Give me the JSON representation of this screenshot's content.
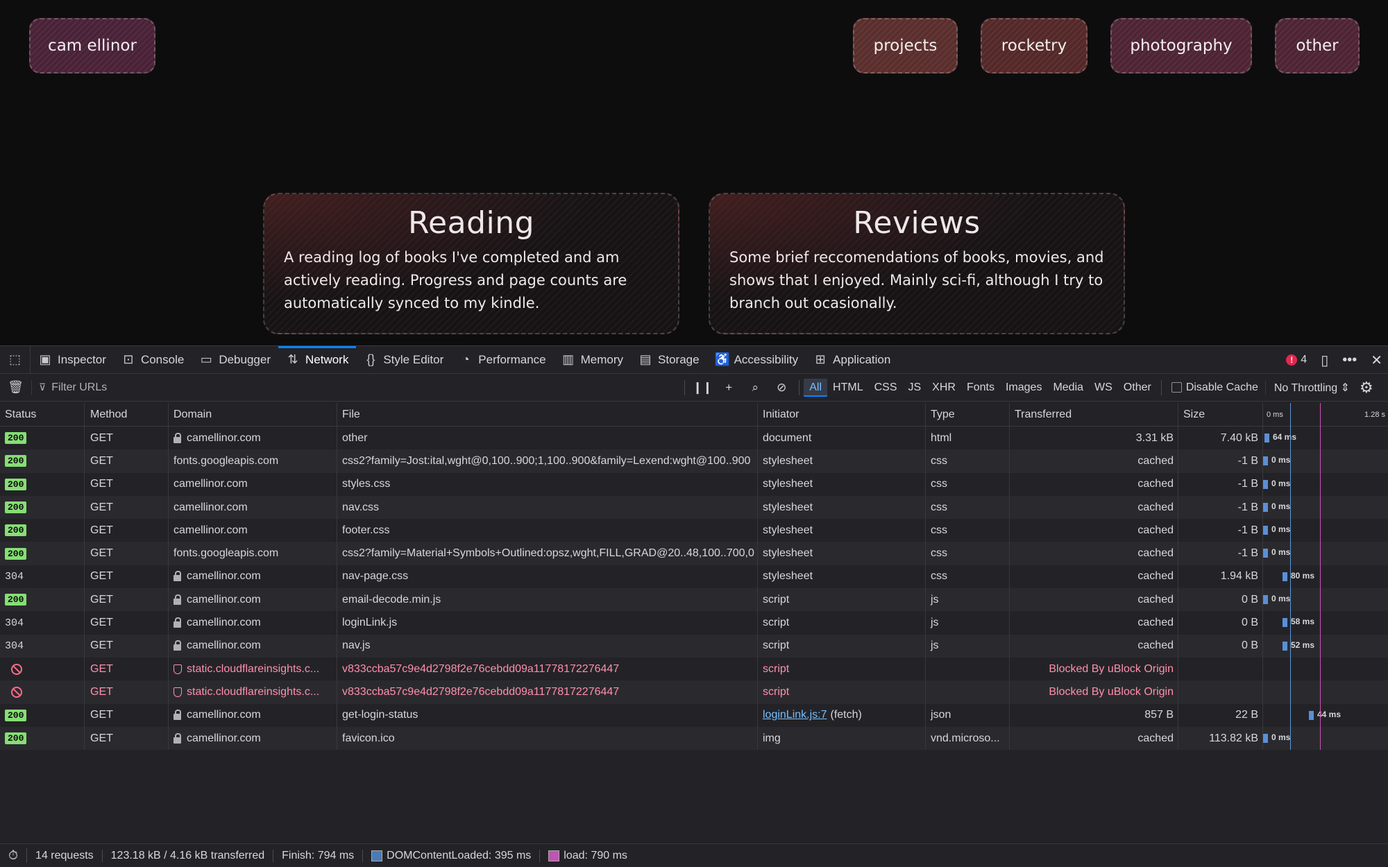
{
  "site": {
    "nav": {
      "home": "cam ellinor",
      "items": [
        "projects",
        "rocketry",
        "photography",
        "other"
      ]
    },
    "cards": [
      {
        "title": "Reading",
        "text": "A reading log of books I've completed and am actively reading. Progress and page counts are automatically synced to my kindle."
      },
      {
        "title": "Reviews",
        "text": "Some brief reccomendations of books, movies, and shows that I enjoyed. Mainly sci-fi, although I try to branch out ocasionally."
      }
    ]
  },
  "devtools": {
    "tabs": [
      {
        "label": "Inspector",
        "icon": "inspector-icon"
      },
      {
        "label": "Console",
        "icon": "console-icon"
      },
      {
        "label": "Debugger",
        "icon": "debugger-icon"
      },
      {
        "label": "Network",
        "icon": "network-icon",
        "active": true
      },
      {
        "label": "Style Editor",
        "icon": "braces-icon"
      },
      {
        "label": "Performance",
        "icon": "gauge-icon"
      },
      {
        "label": "Memory",
        "icon": "memory-icon"
      },
      {
        "label": "Storage",
        "icon": "storage-icon"
      },
      {
        "label": "Accessibility",
        "icon": "accessibility-icon"
      },
      {
        "label": "Application",
        "icon": "grid-icon"
      }
    ],
    "error_count": "4",
    "filter_placeholder": "Filter URLs",
    "type_filters": [
      "All",
      "HTML",
      "CSS",
      "JS",
      "XHR",
      "Fonts",
      "Images",
      "Media",
      "WS",
      "Other"
    ],
    "disable_cache_label": "Disable Cache",
    "throttling": "No Throttling",
    "columns": [
      "Status",
      "Method",
      "Domain",
      "File",
      "Initiator",
      "Type",
      "Transferred",
      "Size"
    ],
    "waterfall_ticks": {
      "start": "0 ms",
      "end": "1.28 s"
    },
    "accent_color": "#0a84ff",
    "requests": [
      {
        "status": "200",
        "method": "GET",
        "domain": "camellinor.com",
        "secure": true,
        "file": "other",
        "initiator": "document",
        "type": "html",
        "transferred": "3.31 kB",
        "size": "7.40 kB",
        "time": "64 ms"
      },
      {
        "status": "200",
        "method": "GET",
        "domain": "fonts.googleapis.com",
        "secure": false,
        "file": "css2?family=Jost:ital,wght@0,100..900;1,100..900&family=Lexend:wght@100..900",
        "initiator": "stylesheet",
        "type": "css",
        "transferred": "cached",
        "size": "-1 B",
        "time": "0 ms"
      },
      {
        "status": "200",
        "method": "GET",
        "domain": "camellinor.com",
        "secure": false,
        "file": "styles.css",
        "initiator": "stylesheet",
        "type": "css",
        "transferred": "cached",
        "size": "-1 B",
        "time": "0 ms"
      },
      {
        "status": "200",
        "method": "GET",
        "domain": "camellinor.com",
        "secure": false,
        "file": "nav.css",
        "initiator": "stylesheet",
        "type": "css",
        "transferred": "cached",
        "size": "-1 B",
        "time": "0 ms"
      },
      {
        "status": "200",
        "method": "GET",
        "domain": "camellinor.com",
        "secure": false,
        "file": "footer.css",
        "initiator": "stylesheet",
        "type": "css",
        "transferred": "cached",
        "size": "-1 B",
        "time": "0 ms"
      },
      {
        "status": "200",
        "method": "GET",
        "domain": "fonts.googleapis.com",
        "secure": false,
        "file": "css2?family=Material+Symbols+Outlined:opsz,wght,FILL,GRAD@20..48,100..700,0",
        "initiator": "stylesheet",
        "type": "css",
        "transferred": "cached",
        "size": "-1 B",
        "time": "0 ms"
      },
      {
        "status": "304",
        "method": "GET",
        "domain": "camellinor.com",
        "secure": true,
        "file": "nav-page.css",
        "initiator": "stylesheet",
        "type": "css",
        "transferred": "cached",
        "size": "1.94 kB",
        "time": "80 ms"
      },
      {
        "status": "200",
        "method": "GET",
        "domain": "camellinor.com",
        "secure": true,
        "file": "email-decode.min.js",
        "initiator": "script",
        "type": "js",
        "transferred": "cached",
        "size": "0 B",
        "time": "0 ms"
      },
      {
        "status": "304",
        "method": "GET",
        "domain": "camellinor.com",
        "secure": true,
        "file": "loginLink.js",
        "initiator": "script",
        "type": "js",
        "transferred": "cached",
        "size": "0 B",
        "time": "58 ms"
      },
      {
        "status": "304",
        "method": "GET",
        "domain": "camellinor.com",
        "secure": true,
        "file": "nav.js",
        "initiator": "script",
        "type": "js",
        "transferred": "cached",
        "size": "0 B",
        "time": "52 ms"
      },
      {
        "status": "blocked",
        "method": "GET",
        "domain": "static.cloudflareinsights.c...",
        "secure": false,
        "file": "v833ccba57c9e4d2798f2e76cebdd09a11778172276447",
        "initiator": "script",
        "type": "",
        "transferred": "Blocked By uBlock Origin",
        "size": "",
        "time": ""
      },
      {
        "status": "blocked",
        "method": "GET",
        "domain": "static.cloudflareinsights.c...",
        "secure": false,
        "file": "v833ccba57c9e4d2798f2e76cebdd09a11778172276447",
        "initiator": "script",
        "type": "",
        "transferred": "Blocked By uBlock Origin",
        "size": "",
        "time": ""
      },
      {
        "status": "200",
        "method": "GET",
        "domain": "camellinor.com",
        "secure": true,
        "file": "get-login-status",
        "initiator_link": "loginLink.js:7",
        "initiator": "(fetch)",
        "type": "json",
        "transferred": "857 B",
        "size": "22 B",
        "time": "44 ms"
      },
      {
        "status": "200",
        "method": "GET",
        "domain": "camellinor.com",
        "secure": true,
        "file": "favicon.ico",
        "initiator": "img",
        "type": "vnd.microso...",
        "transferred": "cached",
        "size": "113.82 kB",
        "time": "0 ms"
      }
    ],
    "statusbar": {
      "requests": "14 requests",
      "transferred": "123.18 kB / 4.16 kB transferred",
      "finish": "Finish: 794 ms",
      "dcl": "DOMContentLoaded: 395 ms",
      "load": "load: 790 ms"
    }
  }
}
